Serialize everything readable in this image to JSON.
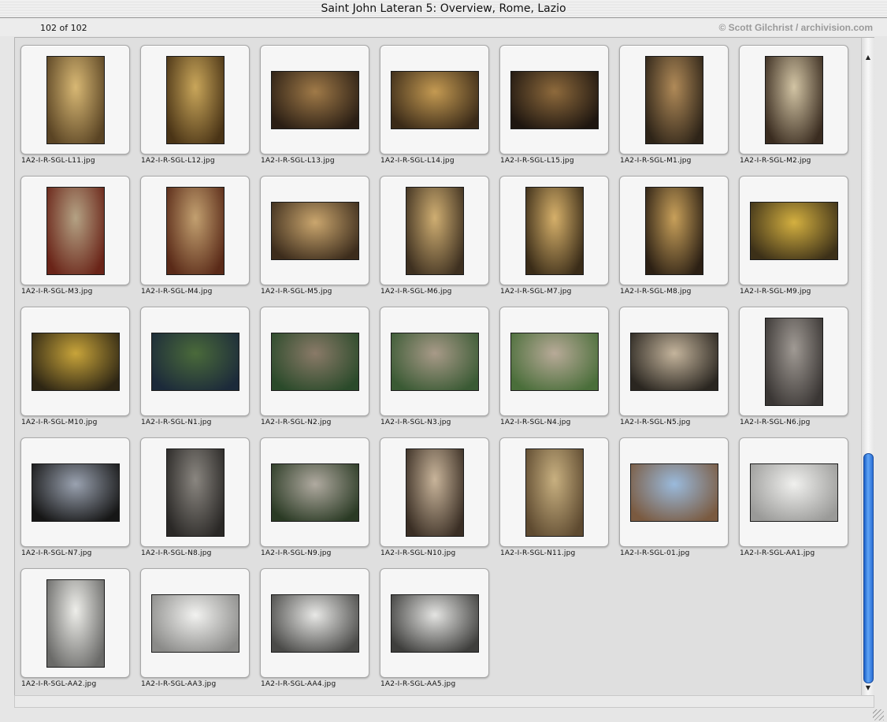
{
  "window": {
    "title": "Saint John Lateran 5: Overview, Rome, Lazio"
  },
  "info": {
    "count": "102 of 102",
    "credit": "© Scott Gilchrist / archivision.com"
  },
  "thumbnails": [
    {
      "name": "1A2-I-R-SGL-L11.jpg",
      "orient": "portrait",
      "c1": "#d8b874",
      "c2": "#5a4424"
    },
    {
      "name": "1A2-I-R-SGL-L12.jpg",
      "orient": "portrait",
      "c1": "#c9a65a",
      "c2": "#4a3416"
    },
    {
      "name": "1A2-I-R-SGL-L13.jpg",
      "orient": "landscape",
      "c1": "#a07a48",
      "c2": "#2a1e14"
    },
    {
      "name": "1A2-I-R-SGL-L14.jpg",
      "orient": "landscape",
      "c1": "#c49a52",
      "c2": "#3a2a18"
    },
    {
      "name": "1A2-I-R-SGL-L15.jpg",
      "orient": "landscape",
      "c1": "#8e6a3c",
      "c2": "#1e1610"
    },
    {
      "name": "1A2-I-R-SGL-M1.jpg",
      "orient": "portrait",
      "c1": "#b08a58",
      "c2": "#2e2418"
    },
    {
      "name": "1A2-I-R-SGL-M2.jpg",
      "orient": "portrait",
      "c1": "#d2c4a4",
      "c2": "#3a2c20"
    },
    {
      "name": "1A2-I-R-SGL-M3.jpg",
      "orient": "portrait",
      "c1": "#b4a284",
      "c2": "#6a2418"
    },
    {
      "name": "1A2-I-R-SGL-M4.jpg",
      "orient": "portrait",
      "c1": "#c2a070",
      "c2": "#5a2a18"
    },
    {
      "name": "1A2-I-R-SGL-M5.jpg",
      "orient": "landscape",
      "c1": "#caa66e",
      "c2": "#3c2c1c"
    },
    {
      "name": "1A2-I-R-SGL-M6.jpg",
      "orient": "portrait",
      "c1": "#cfae72",
      "c2": "#3e3020"
    },
    {
      "name": "1A2-I-R-SGL-M7.jpg",
      "orient": "portrait",
      "c1": "#d6b06a",
      "c2": "#3a2c18"
    },
    {
      "name": "1A2-I-R-SGL-M8.jpg",
      "orient": "portrait",
      "c1": "#c8a05a",
      "c2": "#2c2014"
    },
    {
      "name": "1A2-I-R-SGL-M9.jpg",
      "orient": "landscape",
      "c1": "#d4b040",
      "c2": "#3c3018"
    },
    {
      "name": "1A2-I-R-SGL-M10.jpg",
      "orient": "landscape",
      "c1": "#c8a43a",
      "c2": "#2e2614"
    },
    {
      "name": "1A2-I-R-SGL-N1.jpg",
      "orient": "landscape",
      "c1": "#4a6a3a",
      "c2": "#1c2a3a"
    },
    {
      "name": "1A2-I-R-SGL-N2.jpg",
      "orient": "landscape",
      "c1": "#8a7a68",
      "c2": "#2a4a2a"
    },
    {
      "name": "1A2-I-R-SGL-N3.jpg",
      "orient": "landscape",
      "c1": "#a89a88",
      "c2": "#3a5a34"
    },
    {
      "name": "1A2-I-R-SGL-N4.jpg",
      "orient": "landscape",
      "c1": "#b8aa98",
      "c2": "#4a6e3a"
    },
    {
      "name": "1A2-I-R-SGL-N5.jpg",
      "orient": "landscape",
      "c1": "#c4b49c",
      "c2": "#2a2620"
    },
    {
      "name": "1A2-I-R-SGL-N6.jpg",
      "orient": "portrait",
      "c1": "#a09a94",
      "c2": "#3a3634"
    },
    {
      "name": "1A2-I-R-SGL-N7.jpg",
      "orient": "landscape",
      "c1": "#9aa2b0",
      "c2": "#161616"
    },
    {
      "name": "1A2-I-R-SGL-N8.jpg",
      "orient": "portrait",
      "c1": "#8a8680",
      "c2": "#2a2826"
    },
    {
      "name": "1A2-I-R-SGL-N9.jpg",
      "orient": "landscape",
      "c1": "#b0aaa0",
      "c2": "#2a3a24"
    },
    {
      "name": "1A2-I-R-SGL-N10.jpg",
      "orient": "portrait",
      "c1": "#c8b49a",
      "c2": "#3a2e24"
    },
    {
      "name": "1A2-I-R-SGL-N11.jpg",
      "orient": "portrait",
      "c1": "#c8b080",
      "c2": "#5e4a30"
    },
    {
      "name": "1A2-I-R-SGL-01.jpg",
      "orient": "landscape",
      "c1": "#9abadc",
      "c2": "#7a5a40"
    },
    {
      "name": "1A2-I-R-SGL-AA1.jpg",
      "orient": "landscape",
      "c1": "#f0f0ee",
      "c2": "#9a9a98"
    },
    {
      "name": "1A2-I-R-SGL-AA2.jpg",
      "orient": "portrait",
      "c1": "#eeeeea",
      "c2": "#6a6a68"
    },
    {
      "name": "1A2-I-R-SGL-AA3.jpg",
      "orient": "landscape",
      "c1": "#f2f2f0",
      "c2": "#8a8a88"
    },
    {
      "name": "1A2-I-R-SGL-AA4.jpg",
      "orient": "landscape",
      "c1": "#e8e8e6",
      "c2": "#4a4a48"
    },
    {
      "name": "1A2-I-R-SGL-AA5.jpg",
      "orient": "landscape",
      "c1": "#e4e4e2",
      "c2": "#3e3e3c"
    }
  ]
}
